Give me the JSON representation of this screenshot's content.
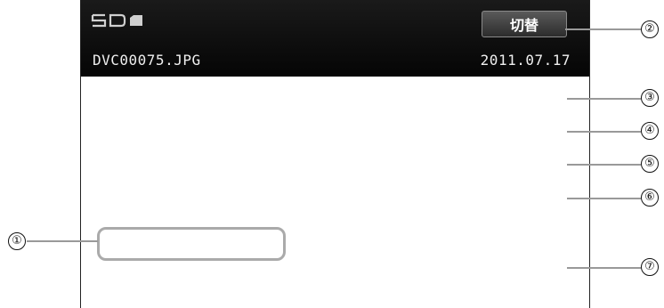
{
  "header": {
    "source_icon": "sd-card-icon",
    "filename": "DVC00075.JPG",
    "date": "2011.07.17",
    "switch_label": "切替"
  },
  "callouts": [
    "①",
    "②",
    "③",
    "④",
    "⑤",
    "⑥",
    "⑦"
  ]
}
